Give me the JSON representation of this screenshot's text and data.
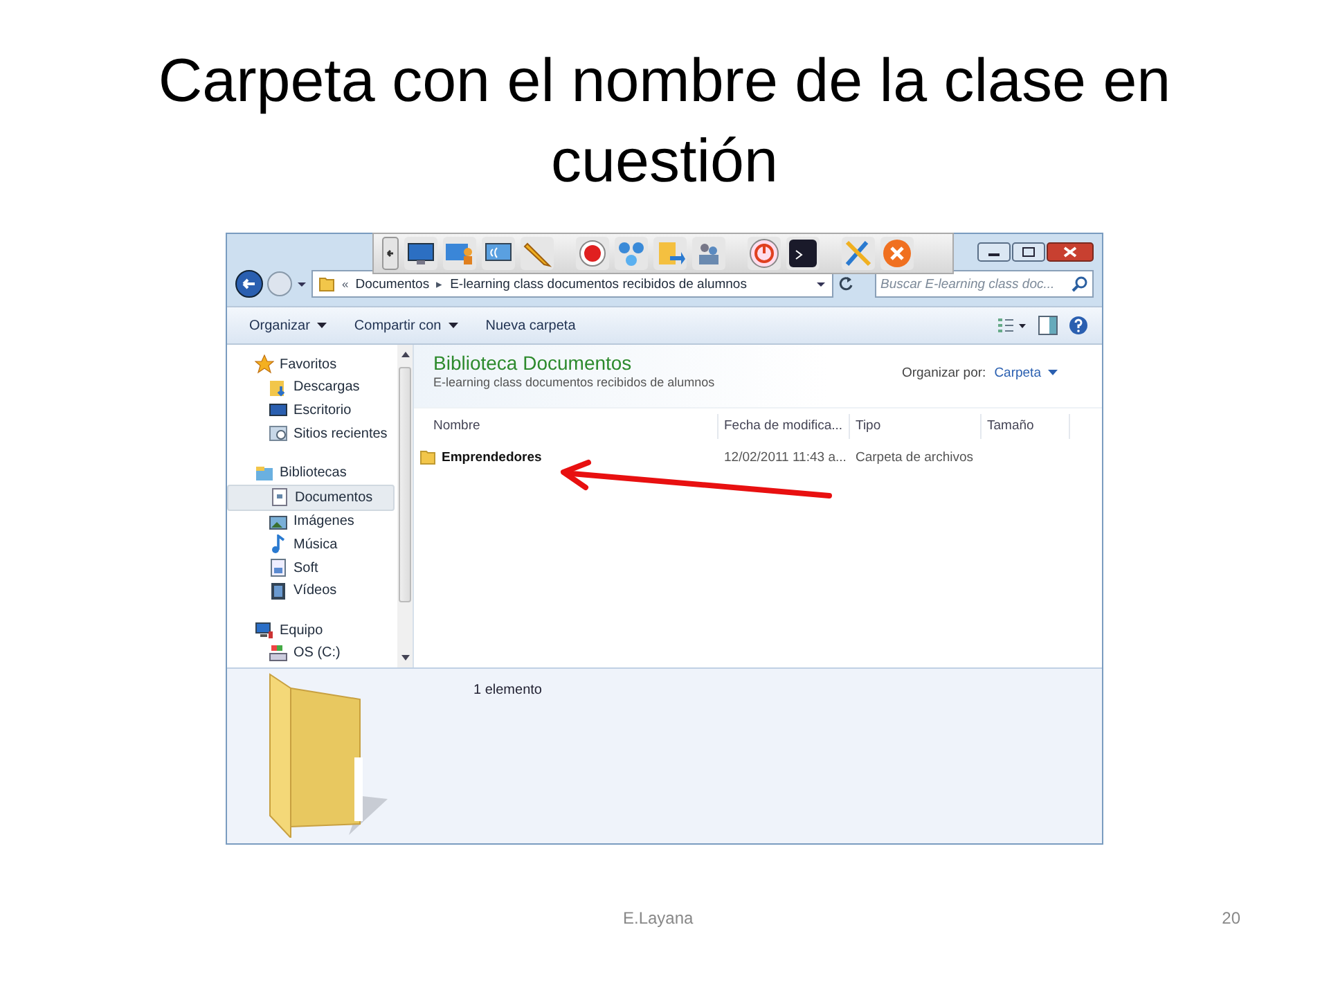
{
  "slide": {
    "title": "Carpeta con el nombre de la clase en cuestión",
    "footer": "E.Layana",
    "page_number": "20"
  },
  "window": {
    "address": {
      "segments": [
        {
          "kind": "separator",
          "text": "«"
        },
        {
          "kind": "crumb",
          "text": "Documentos"
        },
        {
          "kind": "separator",
          "text": "▸"
        },
        {
          "kind": "crumb",
          "text": "E-learning class documentos recibidos de alumnos"
        }
      ]
    },
    "search": {
      "placeholder": "Buscar E-learning class doc..."
    },
    "commands": [
      {
        "label": "Organizar",
        "dropdown": true
      },
      {
        "label": "Compartir con",
        "dropdown": true
      },
      {
        "label": "Nueva carpeta",
        "dropdown": false
      }
    ],
    "sidebar": {
      "groups": [
        {
          "label": "Favoritos",
          "selected": false,
          "children": [
            {
              "label": "Descargas",
              "selected": false
            },
            {
              "label": "Escritorio",
              "selected": false
            },
            {
              "label": "Sitios recientes",
              "selected": false
            }
          ]
        },
        {
          "label": "Bibliotecas",
          "selected": false,
          "children": [
            {
              "label": "Documentos",
              "selected": true
            },
            {
              "label": "Imágenes",
              "selected": false
            },
            {
              "label": "Música",
              "selected": false
            },
            {
              "label": "Soft",
              "selected": false
            },
            {
              "label": "Vídeos",
              "selected": false
            }
          ]
        },
        {
          "label": "Equipo",
          "selected": false,
          "children": [
            {
              "label": "OS (C:)",
              "selected": false
            }
          ]
        }
      ]
    },
    "library": {
      "title": "Biblioteca Documentos",
      "subtitle": "E-learning class documentos recibidos de alumnos",
      "arrange_label": "Organizar por:",
      "arrange_value": "Carpeta"
    },
    "table": {
      "columns": [
        "Nombre",
        "Fecha de modifica...",
        "Tipo",
        "Tamaño"
      ],
      "rows": [
        {
          "name": "Emprendedores",
          "modified": "12/02/2011 11:43 a...",
          "type": "Carpeta de archivos",
          "selected": false
        }
      ]
    },
    "status": "1 elemento"
  }
}
